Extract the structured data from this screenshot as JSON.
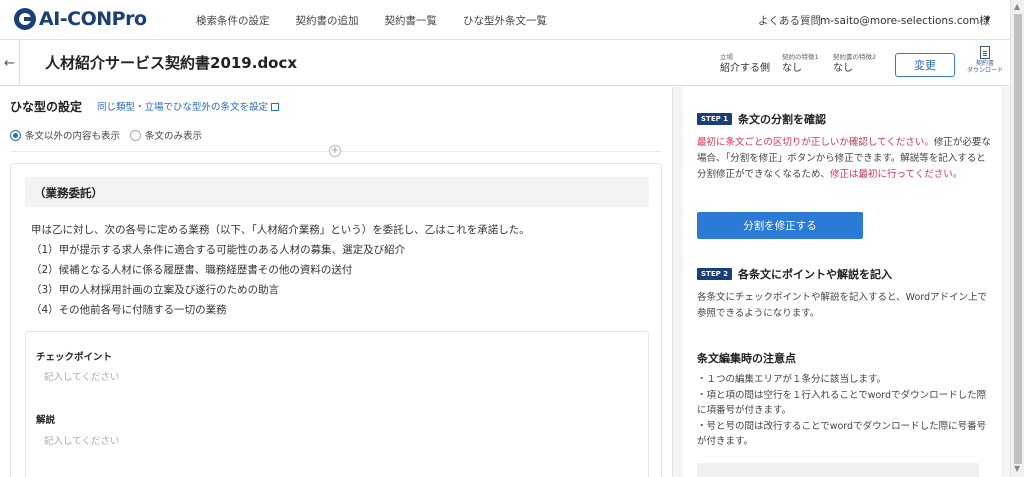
{
  "nav": {
    "logo": "AI-CONPro",
    "links": [
      "検索条件の設定",
      "契約書の追加",
      "契約書一覧",
      "ひな型外条文一覧"
    ],
    "faq": "よくある質問",
    "user": "m-saito@more-selections.com様"
  },
  "doc": {
    "title": "人材紹介サービス契約書2019.docx",
    "meta": [
      {
        "label": "立場",
        "value": "紹介する側"
      },
      {
        "label": "契約の特徴1",
        "value": "なし"
      },
      {
        "label": "契約書の特徴2",
        "value": "なし"
      }
    ],
    "change_label": "変更",
    "download_label_1": "契約書",
    "download_label_2": "ダウンロード"
  },
  "left": {
    "section_title": "ひな型の設定",
    "section_link": "同じ類型・立場でひな型外の条文を設定",
    "radio_1": "条文以外の内容も表示",
    "radio_2": "条文のみ表示",
    "article_heading": "（業務委託）",
    "article_lines": [
      "甲は乙に対し、次の各号に定める業務（以下、「人材紹介業務」という）を委託し、乙はこれを承諾した。",
      "（1）甲が提示する求人条件に適合する可能性のある人材の募集、選定及び紹介",
      "（2）候補となる人材に係る履歴書、職務経歴書その他の資料の送付",
      "（3）甲の人材採用計画の立案及び遂行のための助言",
      "（4）その他前各号に付随する一切の業務"
    ],
    "checkpoint_label": "チェックポイント",
    "checkpoint_placeholder": "記入してください",
    "explain_label": "解説",
    "explain_placeholder": "記入してください"
  },
  "right": {
    "step1_badge": "STEP 1",
    "step1_title": "条文の分割を確認",
    "step1_red1": "最初に条文ごとの区切りが正しいか確認してください。",
    "step1_text": "修正が必要な場合、「分割を修正」ボタンから修正できます。解説等を記入すると分割修正ができなくなるため、",
    "step1_red2": "修正は最初に行ってください。",
    "split_button": "分割を修正する",
    "step2_badge": "STEP 2",
    "step2_title": "各条文にポイントや解説を記入",
    "step2_text": "各条文にチェックポイントや解説を記入すると、Wordアドイン上で参照できるようになります。",
    "notes_title": "条文編集時の注意点",
    "notes": [
      "・１つの編集エリアが１条分に該当します。",
      "・項と項の間は空行を１行入れることでwordでダウンロードした際に項番号が付きます。",
      "・号と号の間は改行することでwordでダウンロードした際に号番号が付きます。"
    ]
  }
}
